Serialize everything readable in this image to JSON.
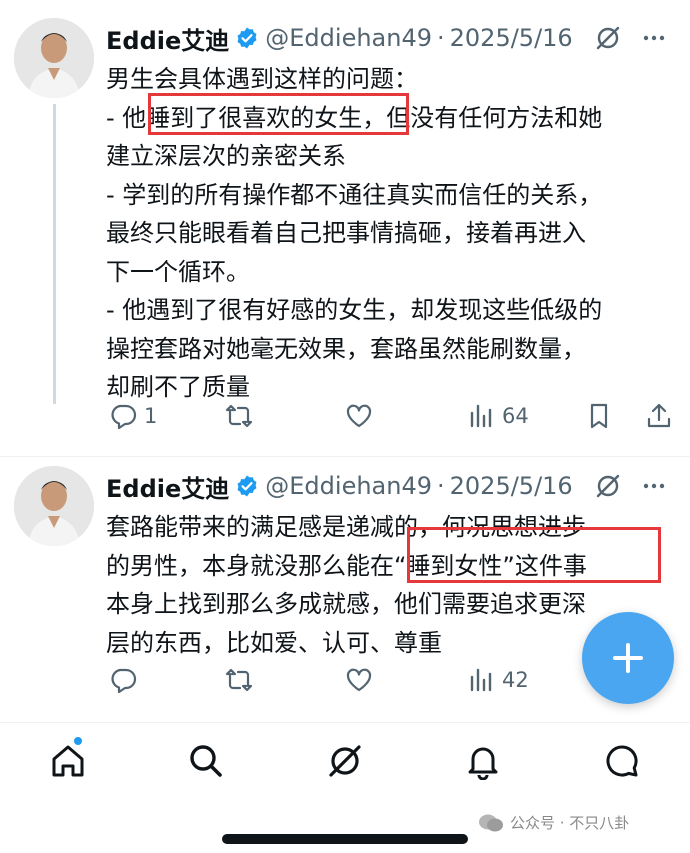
{
  "tweets": [
    {
      "author_name": "Eddie艾迪",
      "handle": "@Eddiehan49",
      "separator": "·",
      "date": "2025/5/16",
      "lines": [
        "男生会具体遇到这样的问题：",
        "- 他睡到了很喜欢的女生，但没有任何方法和她",
        "建立深层次的亲密关系",
        "- 学到的所有操作都不通往真实而信任的关系，",
        "最终只能眼看着自己把事情搞砸，接着再进入",
        "下一个循环。",
        "- 他遇到了很有好感的女生，却发现这些低级的",
        "操控套路对她毫无效果，套路虽然能刷数量，",
        "却刷不了质量"
      ],
      "replies": "1",
      "retweets": "",
      "likes": "",
      "views": "64"
    },
    {
      "author_name": "Eddie艾迪",
      "handle": "@Eddiehan49",
      "separator": "·",
      "date": "2025/5/16",
      "lines": [
        "套路能带来的满足感是递减的，何况思想进步",
        "的男性，本身就没那么能在“睡到女性”这件事",
        "本身上找到那么多成就感，他们需要追求更深",
        "层的东西，比如爱、认可、尊重"
      ],
      "replies": "",
      "retweets": "",
      "likes": "",
      "views": "42"
    }
  ],
  "fab": {
    "icon": "plus-icon"
  },
  "tabbar": {
    "items": [
      "home-icon",
      "search-icon",
      "grok-icon",
      "notifications-icon",
      "messages-icon"
    ]
  },
  "watermark": {
    "text": "公众号 · 不只八卦"
  },
  "colors": {
    "accent": "#1d9bf0",
    "fab": "#4aa6f0",
    "highlight_box": "#e5383b",
    "secondary_text": "#536471"
  }
}
